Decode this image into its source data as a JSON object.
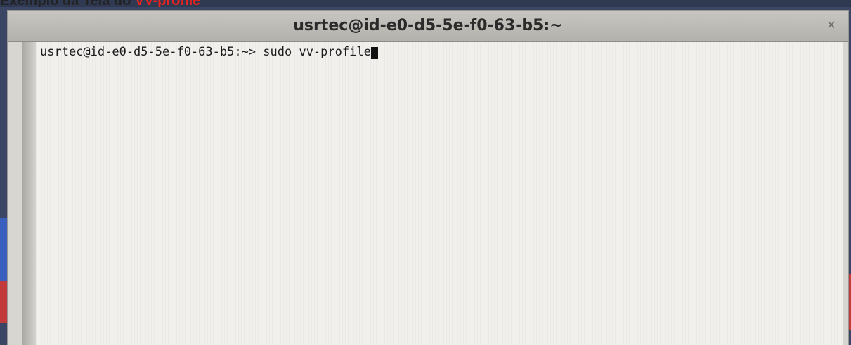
{
  "caption": {
    "prefix": "Exemplo da Tela do ",
    "highlight": "VV-profile"
  },
  "window": {
    "title": "usrtec@id-e0-d5-5e-f0-63-b5:~",
    "close_icon": "close-icon"
  },
  "terminal": {
    "prompt": "usrtec@id-e0-d5-5e-f0-63-b5:~> ",
    "command": "sudo vv-profile"
  }
}
